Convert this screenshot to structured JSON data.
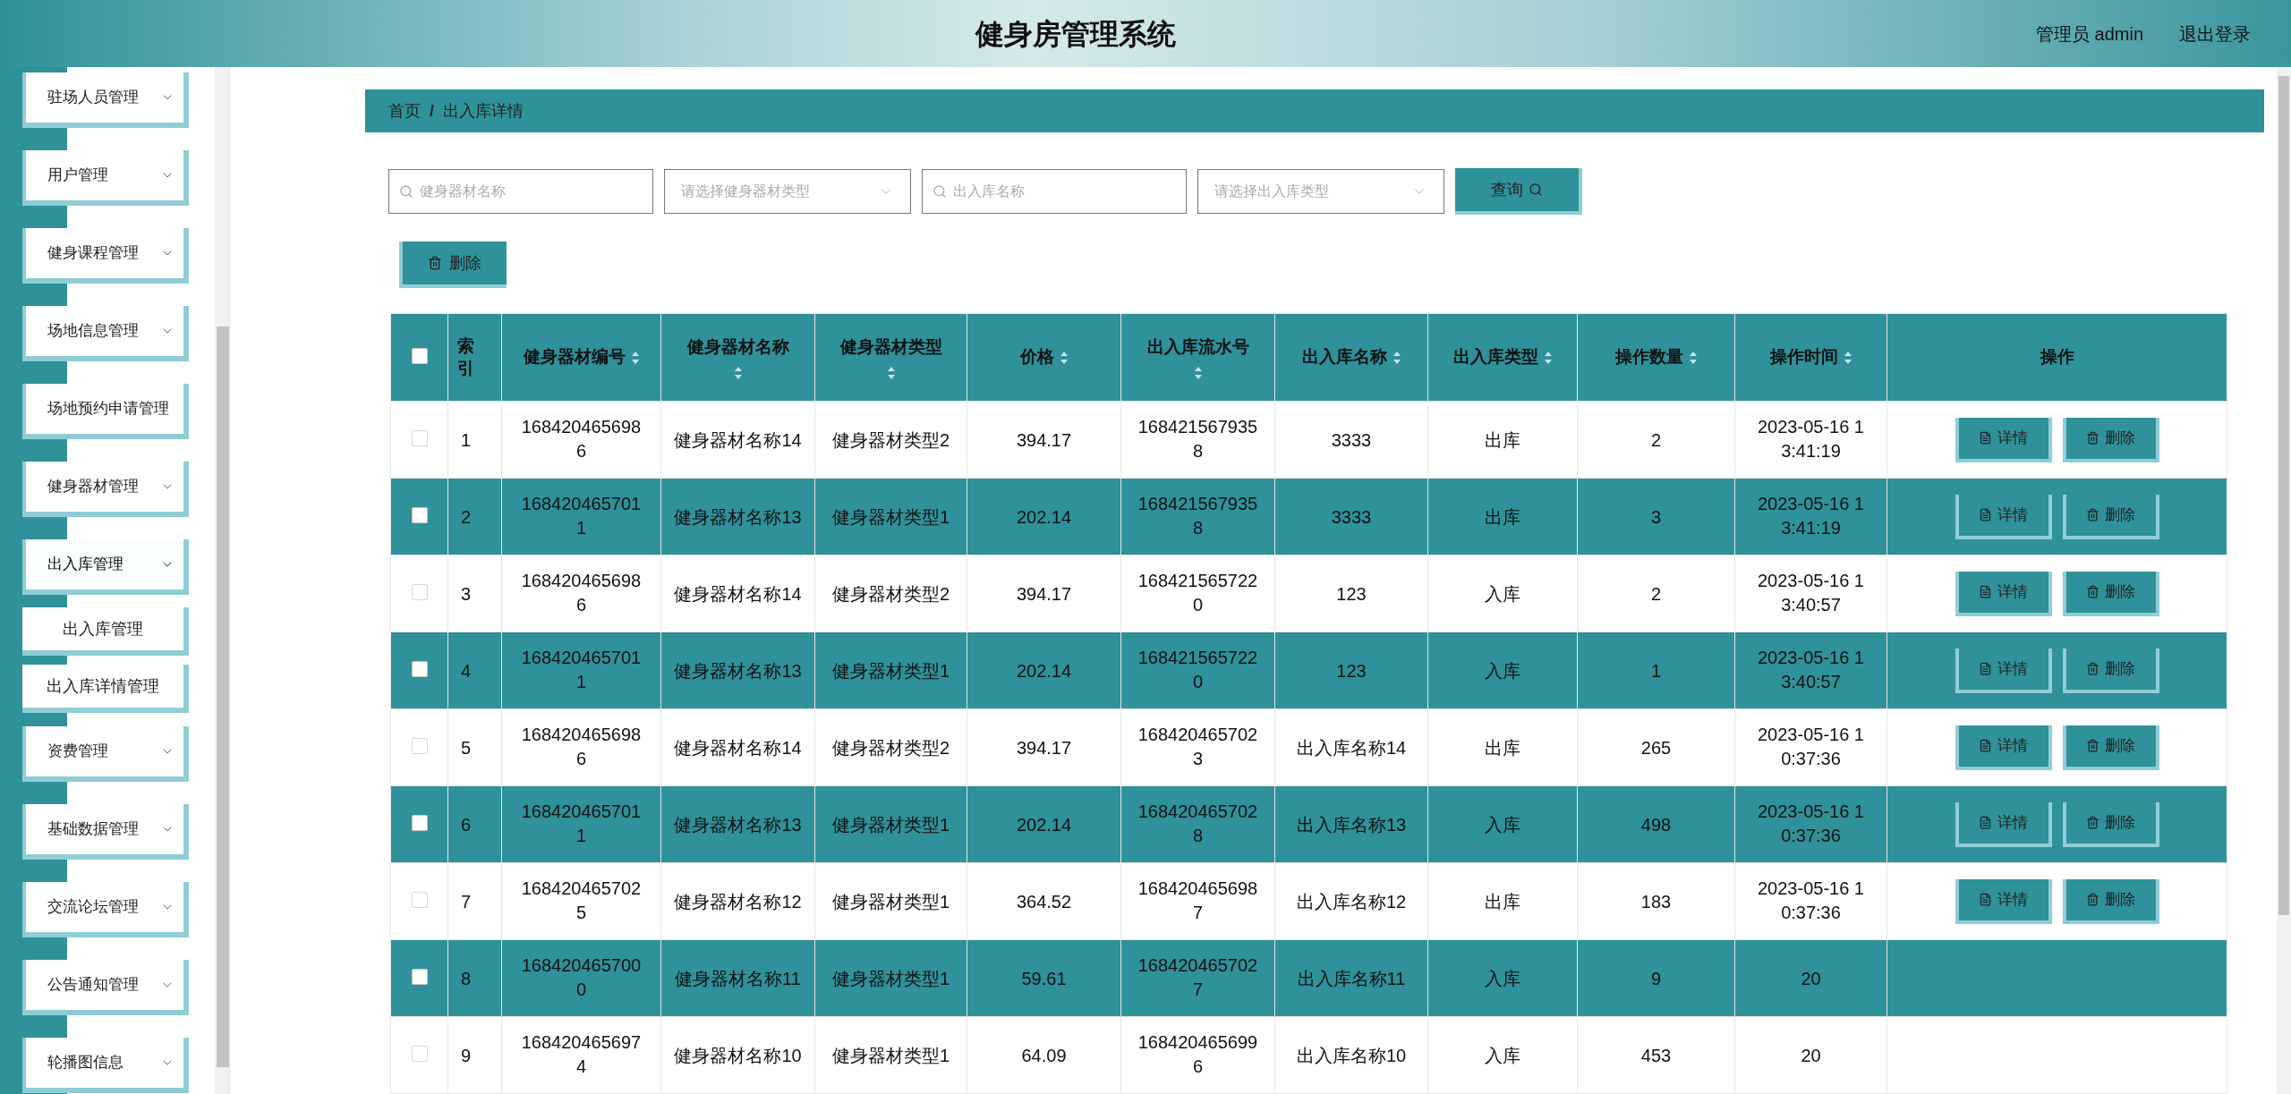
{
  "header": {
    "title": "健身房管理系统",
    "user": "管理员 admin",
    "logout": "退出登录"
  },
  "sidebar": {
    "items": [
      {
        "label": "驻场人员管理",
        "has_arrow": true,
        "expanded": false
      },
      {
        "label": "用户管理",
        "has_arrow": true,
        "expanded": false
      },
      {
        "label": "健身课程管理",
        "has_arrow": true,
        "expanded": false
      },
      {
        "label": "场地信息管理",
        "has_arrow": true,
        "expanded": false
      },
      {
        "label": "场地预约申请管理",
        "has_arrow": false,
        "expanded": false
      },
      {
        "label": "健身器材管理",
        "has_arrow": true,
        "expanded": false
      },
      {
        "label": "出入库管理",
        "has_arrow": true,
        "expanded": true,
        "children": [
          {
            "label": "出入库管理"
          },
          {
            "label": "出入库详情管理"
          }
        ]
      },
      {
        "label": "资费管理",
        "has_arrow": true,
        "expanded": false
      },
      {
        "label": "基础数据管理",
        "has_arrow": true,
        "expanded": false
      },
      {
        "label": "交流论坛管理",
        "has_arrow": true,
        "expanded": false
      },
      {
        "label": "公告通知管理",
        "has_arrow": true,
        "expanded": false
      },
      {
        "label": "轮播图信息",
        "has_arrow": true,
        "expanded": false
      }
    ]
  },
  "breadcrumb": [
    "首页",
    "/",
    "出入库详情"
  ],
  "filters": [
    {
      "kind": "input",
      "placeholder": "健身器材名称"
    },
    {
      "kind": "select",
      "placeholder": "请选择健身器材类型"
    },
    {
      "kind": "input",
      "placeholder": "出入库名称"
    },
    {
      "kind": "select",
      "placeholder": "请选择出入库类型"
    }
  ],
  "search_button": "查询",
  "delete_button": "删除",
  "table": {
    "select_all": {
      "checked": false
    },
    "columns": [
      {
        "label": "索引",
        "sortable": false
      },
      {
        "label": "健身器材编号",
        "sortable": true,
        "sort_below": false
      },
      {
        "label": "健身器材名称",
        "sortable": true,
        "sort_below": true
      },
      {
        "label": "健身器材类型",
        "sortable": true,
        "sort_below": true
      },
      {
        "label": "价格",
        "sortable": true,
        "sort_below": false
      },
      {
        "label": "出入库流水号",
        "sortable": true,
        "sort_below": true
      },
      {
        "label": "出入库名称",
        "sortable": true,
        "sort_below": false
      },
      {
        "label": "出入库类型",
        "sortable": true,
        "sort_below": false
      },
      {
        "label": "操作数量",
        "sortable": true,
        "sort_below": false
      },
      {
        "label": "操作时间",
        "sortable": true,
        "sort_below": false
      },
      {
        "label": "操作",
        "sortable": false
      }
    ],
    "rows": [
      {
        "checked": false,
        "cells": [
          "1",
          "1684204656986",
          "健身器材名称14",
          "健身器材类型2",
          "394.17",
          "1684215679358",
          "3333",
          "出库",
          "2",
          "2023-05-16 13:41:19"
        ],
        "actions": [
          "详情",
          "删除"
        ]
      },
      {
        "checked": false,
        "cells": [
          "2",
          "1684204657011",
          "健身器材名称13",
          "健身器材类型1",
          "202.14",
          "1684215679358",
          "3333",
          "出库",
          "3",
          "2023-05-16 13:41:19"
        ],
        "actions": [
          "详情",
          "删除"
        ]
      },
      {
        "checked": false,
        "cells": [
          "3",
          "1684204656986",
          "健身器材名称14",
          "健身器材类型2",
          "394.17",
          "1684215657220",
          "123",
          "入库",
          "2",
          "2023-05-16 13:40:57"
        ],
        "actions": [
          "详情",
          "删除"
        ]
      },
      {
        "checked": false,
        "cells": [
          "4",
          "1684204657011",
          "健身器材名称13",
          "健身器材类型1",
          "202.14",
          "1684215657220",
          "123",
          "入库",
          "1",
          "2023-05-16 13:40:57"
        ],
        "actions": [
          "详情",
          "删除"
        ]
      },
      {
        "checked": false,
        "cells": [
          "5",
          "1684204656986",
          "健身器材名称14",
          "健身器材类型2",
          "394.17",
          "1684204657023",
          "出入库名称14",
          "出库",
          "265",
          "2023-05-16 10:37:36"
        ],
        "actions": [
          "详情",
          "删除"
        ]
      },
      {
        "checked": false,
        "cells": [
          "6",
          "1684204657011",
          "健身器材名称13",
          "健身器材类型1",
          "202.14",
          "1684204657028",
          "出入库名称13",
          "入库",
          "498",
          "2023-05-16 10:37:36"
        ],
        "actions": [
          "详情",
          "删除"
        ]
      },
      {
        "checked": false,
        "cells": [
          "7",
          "1684204657025",
          "健身器材名称12",
          "健身器材类型1",
          "364.52",
          "1684204656987",
          "出入库名称12",
          "出库",
          "183",
          "2023-05-16 10:37:36"
        ],
        "actions": [
          "详情",
          "删除"
        ]
      },
      {
        "checked": false,
        "cells": [
          "8",
          "1684204657000",
          "健身器材名称11",
          "健身器材类型1",
          "59.61",
          "1684204657027",
          "出入库名称11",
          "入库",
          "9",
          "20"
        ]
      },
      {
        "checked": false,
        "cells": [
          "9",
          "1684204656974",
          "健身器材名称10",
          "健身器材类型1",
          "64.09",
          "1684204656996",
          "出入库名称10",
          "入库",
          "453",
          "20"
        ]
      }
    ]
  }
}
